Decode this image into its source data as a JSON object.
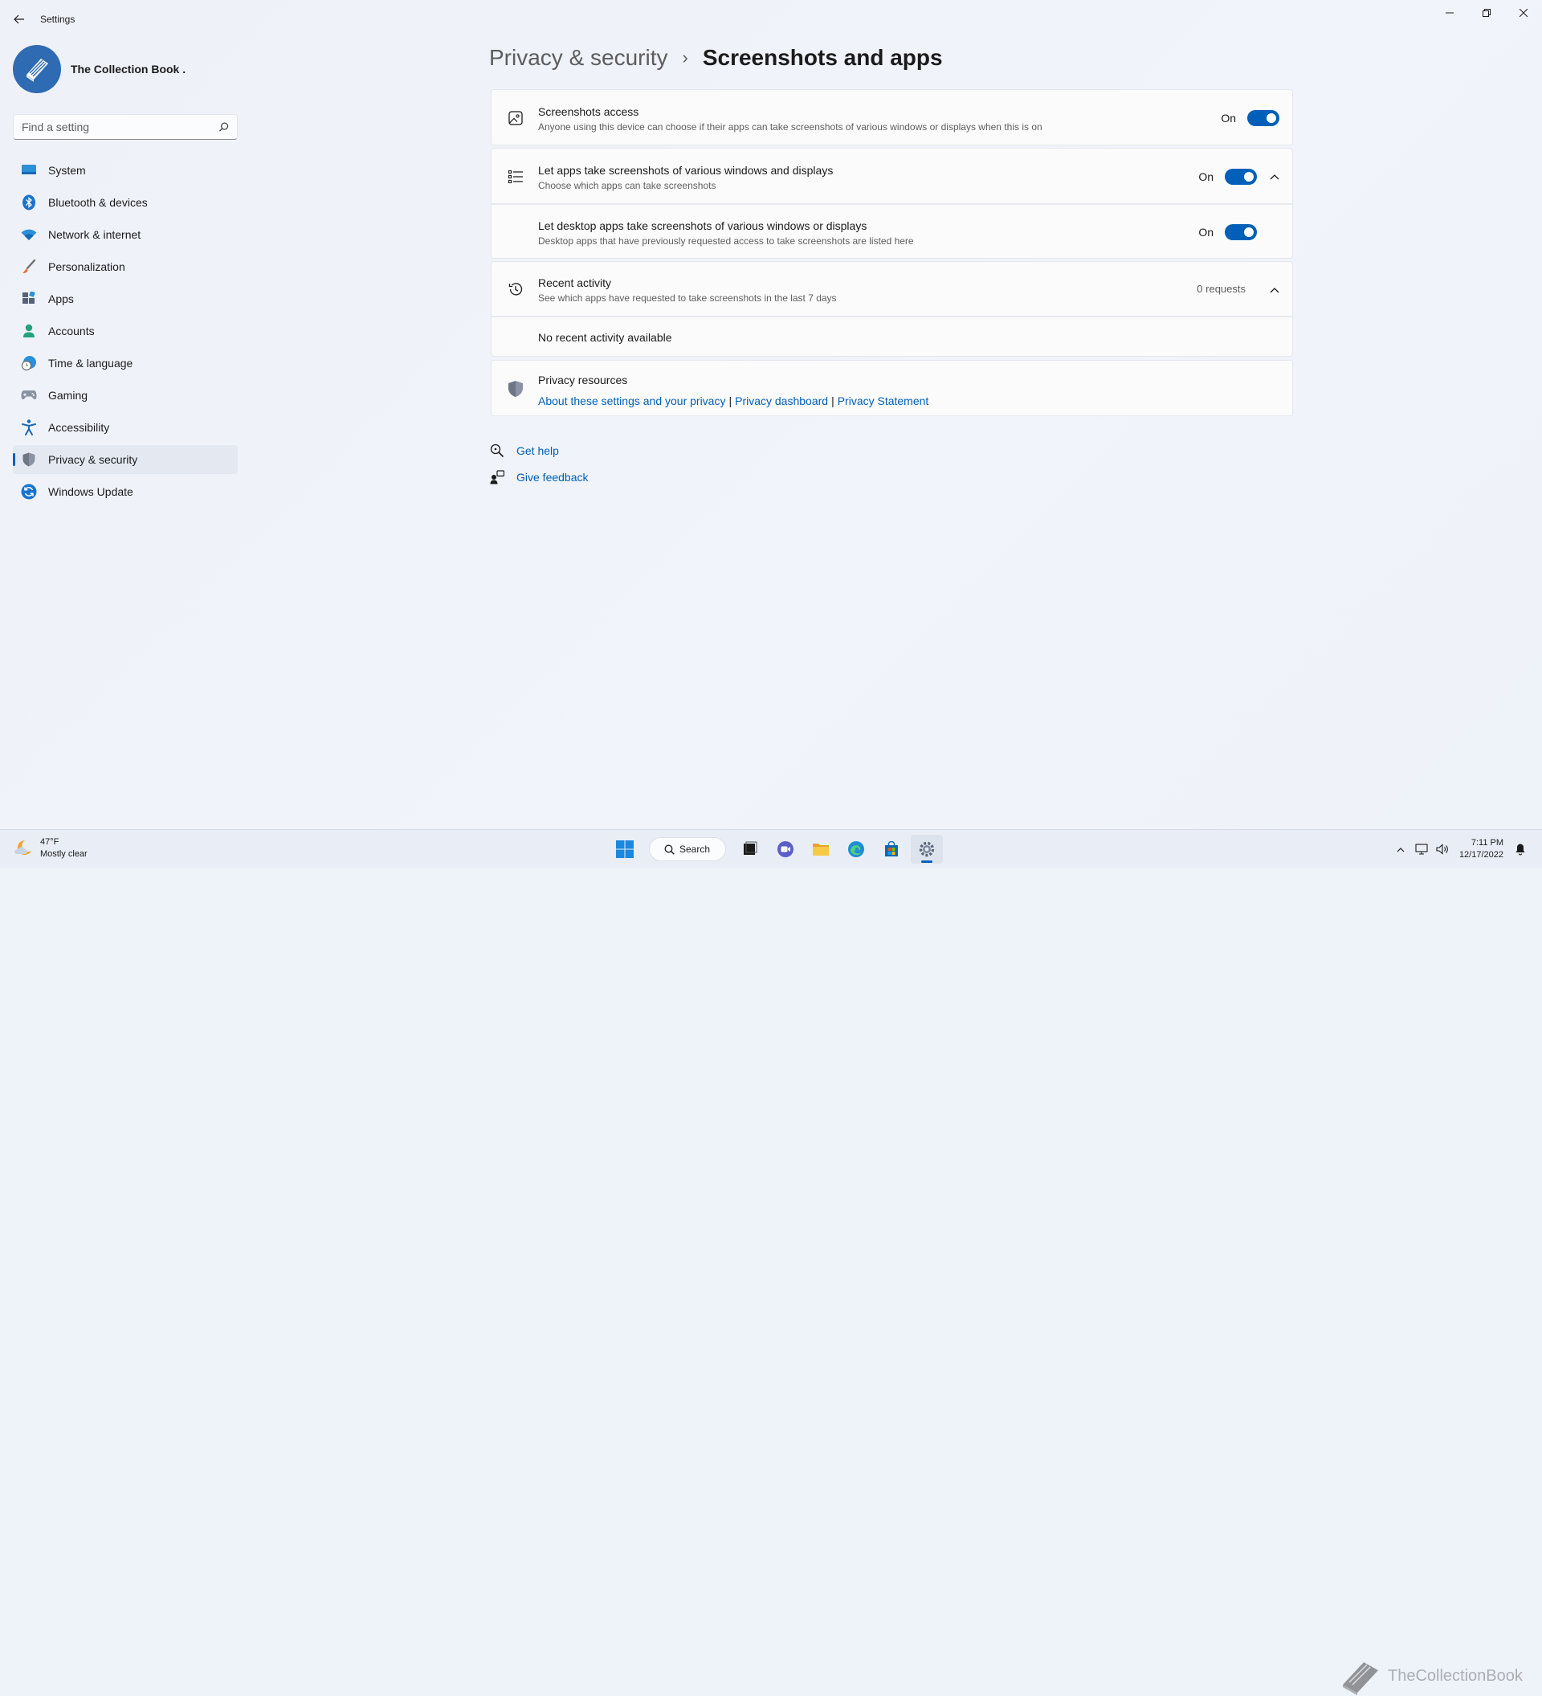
{
  "window": {
    "title": "Settings"
  },
  "profile": {
    "name": "The Collection Book ."
  },
  "search": {
    "placeholder": "Find a setting"
  },
  "sidebar": {
    "items": [
      {
        "label": "System",
        "icon": "monitor-icon"
      },
      {
        "label": "Bluetooth & devices",
        "icon": "bluetooth-icon"
      },
      {
        "label": "Network & internet",
        "icon": "wifi-icon"
      },
      {
        "label": "Personalization",
        "icon": "brush-icon"
      },
      {
        "label": "Apps",
        "icon": "apps-icon"
      },
      {
        "label": "Accounts",
        "icon": "person-icon"
      },
      {
        "label": "Time & language",
        "icon": "clock-globe-icon"
      },
      {
        "label": "Gaming",
        "icon": "gamepad-icon"
      },
      {
        "label": "Accessibility",
        "icon": "accessibility-icon"
      },
      {
        "label": "Privacy & security",
        "icon": "shield-icon",
        "active": true
      },
      {
        "label": "Windows Update",
        "icon": "update-icon"
      }
    ]
  },
  "breadcrumb": {
    "parent": "Privacy & security",
    "separator": "›",
    "current": "Screenshots and apps"
  },
  "cards": {
    "screenshots_access": {
      "title": "Screenshots access",
      "description": "Anyone using this device can choose if their apps can take screenshots of various windows or displays when this is on",
      "state": "On"
    },
    "let_apps": {
      "title": "Let apps take screenshots of various windows and displays",
      "description": "Choose which apps can take screenshots",
      "state": "On"
    },
    "desktop_apps": {
      "title": "Let desktop apps take screenshots of various windows or displays",
      "description": "Desktop apps that have previously requested access to take screenshots are listed here",
      "state": "On"
    },
    "recent_activity": {
      "title": "Recent activity",
      "description": "See which apps have requested to take screenshots in the last 7 days",
      "count": "0 requests"
    },
    "no_activity": {
      "text": "No recent activity available"
    },
    "privacy_resources": {
      "title": "Privacy resources",
      "links": [
        "About these settings and your privacy",
        "Privacy dashboard",
        "Privacy Statement"
      ],
      "separator": "|"
    }
  },
  "help": {
    "get_help": "Get help",
    "give_feedback": "Give feedback"
  },
  "taskbar": {
    "weather_temp": "47°F",
    "weather_desc": "Mostly clear",
    "search_label": "Search",
    "time": "7:11 PM",
    "date": "12/17/2022",
    "watermark": "TheCollectionBook"
  },
  "colors": {
    "accent": "#005fb8",
    "background": "#eef2f9",
    "card": "#fbfbfc"
  }
}
